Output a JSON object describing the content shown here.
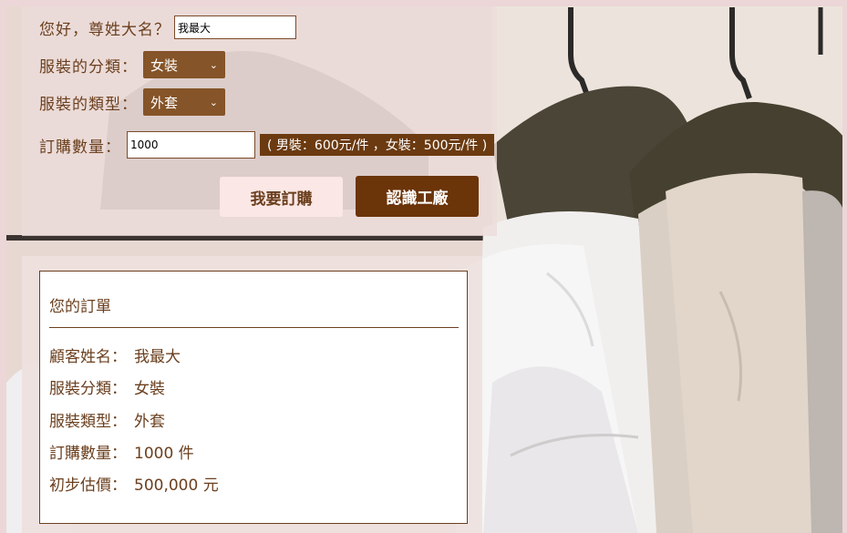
{
  "form": {
    "name_label": "您好，尊姓大名？",
    "name_value": "我最大",
    "category_label": "服裝的分類：",
    "category_selected": "女裝",
    "type_label": "服裝的類型：",
    "type_selected": "外套",
    "quantity_label": "訂購數量：",
    "quantity_value": "1000",
    "price_note": "( 男裝：600元/件 ，女裝：500元/件 )"
  },
  "buttons": {
    "order": "我要訂購",
    "factory": "認識工廠"
  },
  "order": {
    "title": "您的訂單",
    "customer_label": "顧客姓名：",
    "customer_value": "我最大",
    "category_label": "服裝分類：",
    "category_value": "女裝",
    "type_label": "服裝類型：",
    "type_value": "外套",
    "quantity_label": "訂購數量：",
    "quantity_value": "1000 件",
    "price_label": "初步估價：",
    "price_value": "500,000 元"
  },
  "colors": {
    "accent_dark": "#6b3409",
    "select_bg": "#855428",
    "text": "#6b3f1e",
    "button_light": "#fbe7e5"
  }
}
